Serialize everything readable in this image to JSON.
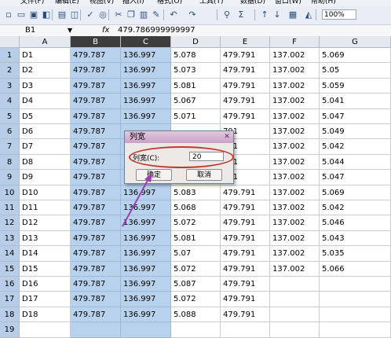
{
  "menu": [
    "文件(F)",
    "编辑(E)",
    "视图(V)",
    "插入(I)",
    "格式(O)",
    "工具(T)",
    "数据(D)",
    "窗口(W)",
    "帮助(H)"
  ],
  "toolbar": {
    "zoom": "100%",
    "icons": [
      "new-icon",
      "open-icon",
      "save-icon",
      "permission-icon",
      "print-icon",
      "print-preview-icon",
      "spelling-icon",
      "research-icon",
      "cut-icon",
      "copy-icon",
      "paste-icon",
      "format-painter-icon",
      "undo-icon",
      "redo-icon",
      "hyperlink-icon",
      "autosum-icon",
      "sort-ascending-icon",
      "sort-descending-icon",
      "chart-icon",
      "drawing-icon"
    ]
  },
  "formula_bar": {
    "name_box": "B1",
    "fx": "fx",
    "value": "479.786999999997"
  },
  "columns": [
    "A",
    "B",
    "C",
    "D",
    "E",
    "F",
    "G"
  ],
  "rows": [
    {
      "n": "1",
      "cells": [
        "D1",
        "479.787",
        "136.997",
        "5.078",
        "479.791",
        "137.002",
        "5.069"
      ]
    },
    {
      "n": "2",
      "cells": [
        "D2",
        "479.787",
        "136.997",
        "5.073",
        "479.791",
        "137.002",
        "5.05"
      ]
    },
    {
      "n": "3",
      "cells": [
        "D3",
        "479.787",
        "136.997",
        "5.081",
        "479.791",
        "137.002",
        "5.059"
      ]
    },
    {
      "n": "4",
      "cells": [
        "D4",
        "479.787",
        "136.997",
        "5.067",
        "479.791",
        "137.002",
        "5.041"
      ]
    },
    {
      "n": "5",
      "cells": [
        "D5",
        "479.787",
        "136.997",
        "5.071",
        "479.791",
        "137.002",
        "5.047"
      ]
    },
    {
      "n": "6",
      "cells": [
        "D6",
        "479.787",
        "",
        "",
        "791",
        "137.002",
        "5.049"
      ]
    },
    {
      "n": "7",
      "cells": [
        "D7",
        "479.787",
        "",
        "",
        "791",
        "137.002",
        "5.042"
      ]
    },
    {
      "n": "8",
      "cells": [
        "D8",
        "479.787",
        "",
        "",
        "791",
        "137.002",
        "5.044"
      ]
    },
    {
      "n": "9",
      "cells": [
        "D9",
        "479.787",
        "",
        "",
        "791",
        "137.002",
        "5.047"
      ]
    },
    {
      "n": "10",
      "cells": [
        "D10",
        "479.787",
        "136.997",
        "5.083",
        "479.791",
        "137.002",
        "5.069"
      ]
    },
    {
      "n": "11",
      "cells": [
        "D11",
        "479.787",
        "136.997",
        "5.068",
        "479.791",
        "137.002",
        "5.042"
      ]
    },
    {
      "n": "12",
      "cells": [
        "D12",
        "479.787",
        "136.997",
        "5.072",
        "479.791",
        "137.002",
        "5.046"
      ]
    },
    {
      "n": "13",
      "cells": [
        "D13",
        "479.787",
        "136.997",
        "5.081",
        "479.791",
        "137.002",
        "5.043"
      ]
    },
    {
      "n": "14",
      "cells": [
        "D14",
        "479.787",
        "136.997",
        "5.07",
        "479.791",
        "137.002",
        "5.035"
      ]
    },
    {
      "n": "15",
      "cells": [
        "D15",
        "479.787",
        "136.997",
        "5.072",
        "479.791",
        "137.002",
        "5.066"
      ]
    },
    {
      "n": "16",
      "cells": [
        "D16",
        "479.787",
        "136.997",
        "5.087",
        "479.791",
        "",
        ""
      ]
    },
    {
      "n": "17",
      "cells": [
        "D17",
        "479.787",
        "136.997",
        "5.072",
        "479.791",
        "",
        ""
      ]
    },
    {
      "n": "18",
      "cells": [
        "D18",
        "479.787",
        "136.997",
        "5.088",
        "479.791",
        "",
        ""
      ]
    },
    {
      "n": "19",
      "cells": [
        "",
        "",
        "",
        "",
        "",
        "",
        ""
      ]
    }
  ],
  "dialog": {
    "title": "列宽",
    "label": "列宽(C):",
    "value": "20",
    "ok": "确定",
    "cancel": "取消"
  },
  "colors": {
    "selection": "#b8d2ee",
    "selected_header": "#3d3d3d",
    "annotation": "#c0392b",
    "arrow": "#9b3fb5"
  }
}
